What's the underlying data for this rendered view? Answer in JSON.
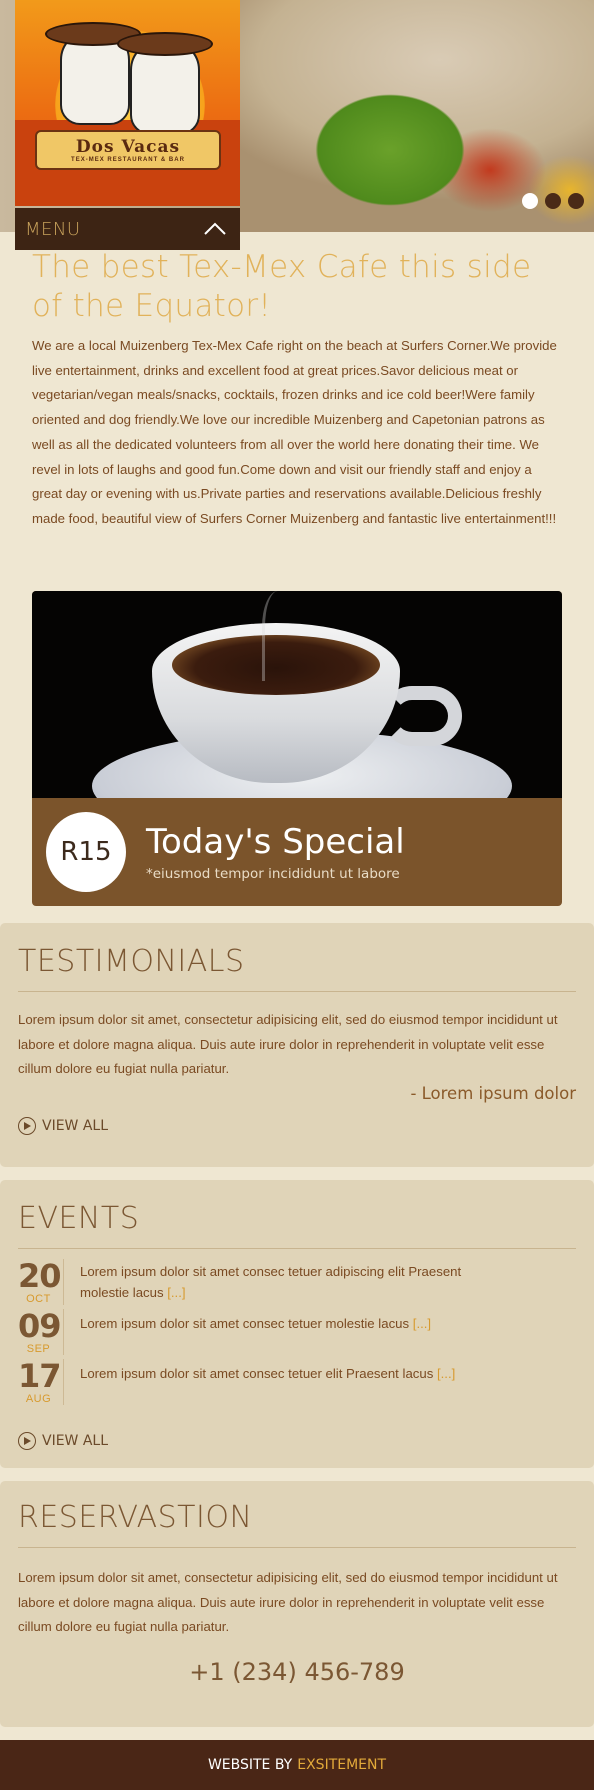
{
  "header": {
    "logo": {
      "name": "Dos Vacas",
      "tagline": "TEX-MEX RESTAURANT & BAR"
    },
    "menu_label": "MENU",
    "slider_dots": [
      "slide-1",
      "slide-2",
      "slide-3"
    ]
  },
  "intro": {
    "title": "The best Tex-Mex Cafe this side of the Equator!",
    "text": "We are a local Muizenberg Tex-Mex Cafe right on the beach at Surfers Corner.We provide live entertainment, drinks and excellent food at great prices.Savor delicious meat or vegetarian/vegan meals/snacks, cocktails, frozen drinks and ice cold beer!Were family oriented and dog friendly.We love our incredible Muizenberg and Capetonian patrons as well as all the dedicated volunteers from all over the world here donating their time. We revel in lots of laughs and good fun.Come down and visit our friendly staff and enjoy a great day or evening with us.Private parties and reservations available.Delicious freshly made food, beautiful view of Surfers Corner Muizenberg and fantastic live entertainment!!!"
  },
  "special": {
    "price": "R15",
    "title": "Today's Special",
    "subtitle": "*eiusmod tempor incididunt ut labore"
  },
  "testimonials": {
    "title": "TESTIMONIALS",
    "text": "Lorem ipsum dolor sit amet, consectetur adipisicing elit, sed do eiusmod tempor incididunt ut labore et dolore magna aliqua. Duis aute irure dolor in reprehenderit in voluptate velit esse cillum dolore eu fugiat nulla pariatur.",
    "author": "- Lorem ipsum dolor",
    "view_all": "VIEW ALL"
  },
  "events": {
    "title": "EVENTS",
    "items": [
      {
        "day": "20",
        "month": "OCT",
        "text": "Lorem ipsum dolor sit amet consec tetuer adipiscing elit Praesent molestie lacus",
        "more": "[...]"
      },
      {
        "day": "09",
        "month": "SEP",
        "text": "Lorem ipsum dolor sit amet consec tetuer molestie lacus",
        "more": "[...]"
      },
      {
        "day": "17",
        "month": "AUG",
        "text": "Lorem ipsum dolor sit amet consec tetuer elit Praesent lacus",
        "more": "[...]"
      }
    ],
    "view_all": "VIEW ALL"
  },
  "reservation": {
    "title": "RESERVASTION",
    "text": "Lorem ipsum dolor sit amet, consectetur adipisicing elit, sed do eiusmod tempor incididunt ut labore et dolore magna aliqua. Duis aute irure dolor in reprehenderit in voluptate velit esse cillum dolore eu fugiat nulla pariatur.",
    "phone": "+1 (234) 456-789"
  },
  "footer": {
    "prefix": "WEBSITE BY",
    "brand": "EXSITEMENT"
  },
  "colors": {
    "background": "#efe7d2",
    "panel": "#e0d4b8",
    "accent_gold": "#e1b25a",
    "brown": "#7b542b",
    "dark_brown": "#4a2616",
    "link_orange": "#d79a2e"
  }
}
